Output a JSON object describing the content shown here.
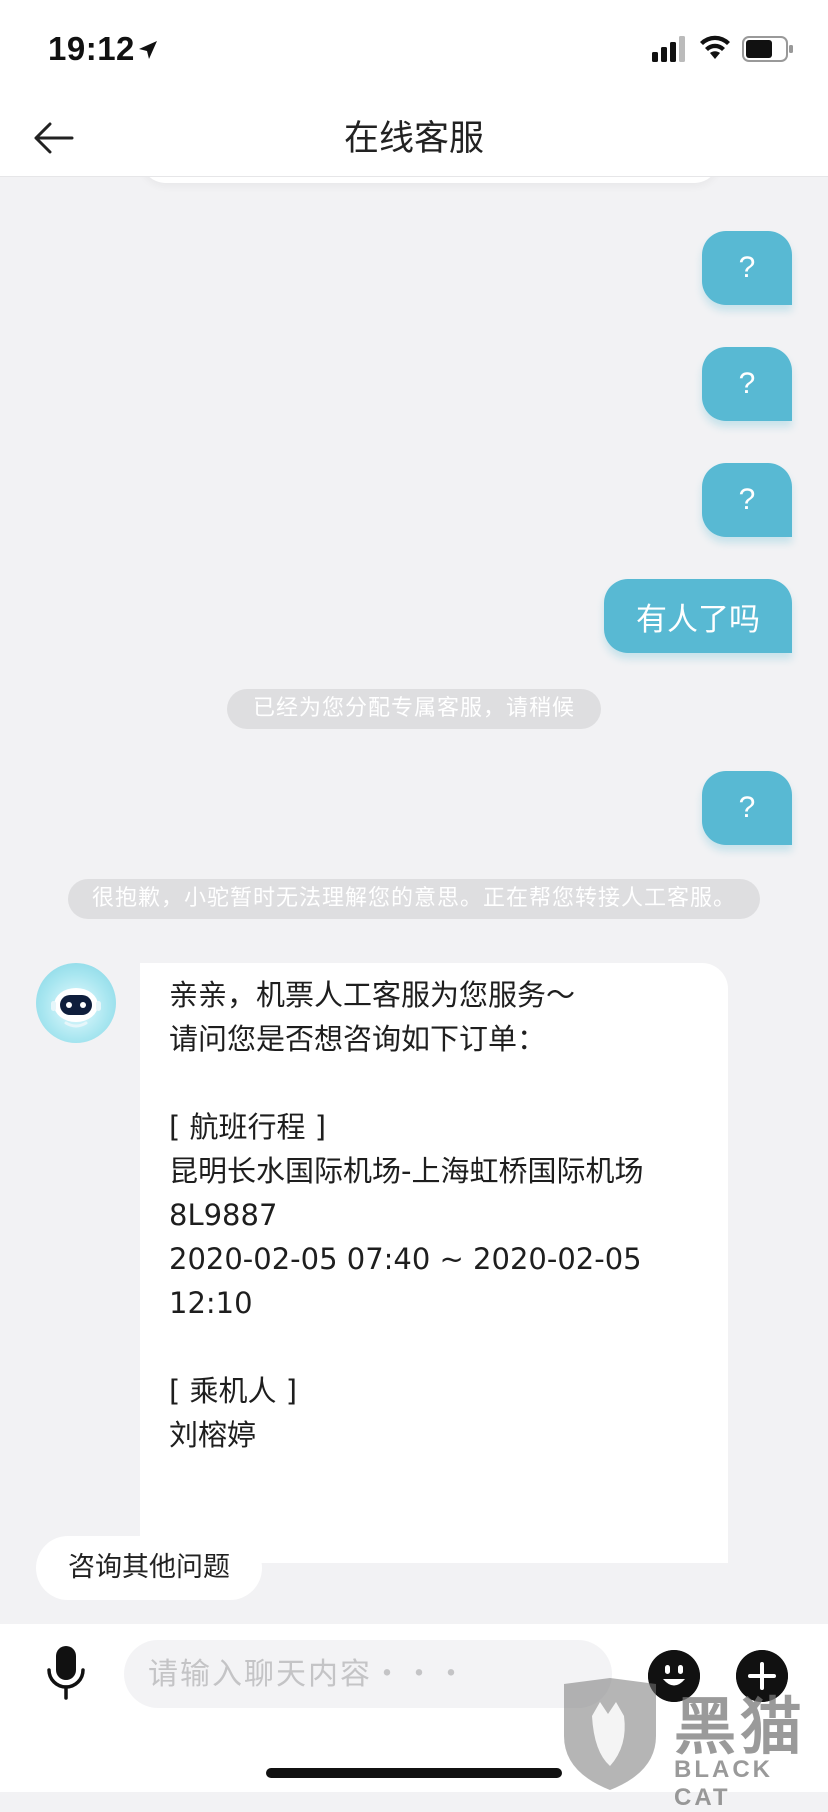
{
  "status_bar": {
    "time": "19:12"
  },
  "nav": {
    "title": "在线客服"
  },
  "messages": {
    "q1": "?",
    "q2": "?",
    "q3": "?",
    "user_text": "有人了吗",
    "system_assign": "已经为您分配专属客服，请稍候",
    "q4": "?",
    "system_transfer": "很抱歉，小驼暂时无法理解您的意思。正在帮您转接人工客服。",
    "agent": {
      "greeting": "亲亲，机票人工客服为您服务～",
      "question": "请问您是否想咨询如下订单：",
      "flight_header": "[ 航班行程 ]",
      "route": "昆明长水国际机场-上海虹桥国际机场",
      "flight_no": "8L9887",
      "time_range": "2020-02-05 07:40 ~ 2020-02-05 12:10",
      "passenger_header": "[ 乘机人 ]",
      "passenger": "刘榕婷"
    }
  },
  "quick_reply": {
    "label": "咨询其他问题"
  },
  "input": {
    "placeholder": "请输入聊天内容・・・"
  },
  "watermark": {
    "cn": "黑猫",
    "en": "BLACK CAT"
  },
  "colors": {
    "bubble_out": "#58b9d3",
    "background": "#f2f2f4"
  }
}
